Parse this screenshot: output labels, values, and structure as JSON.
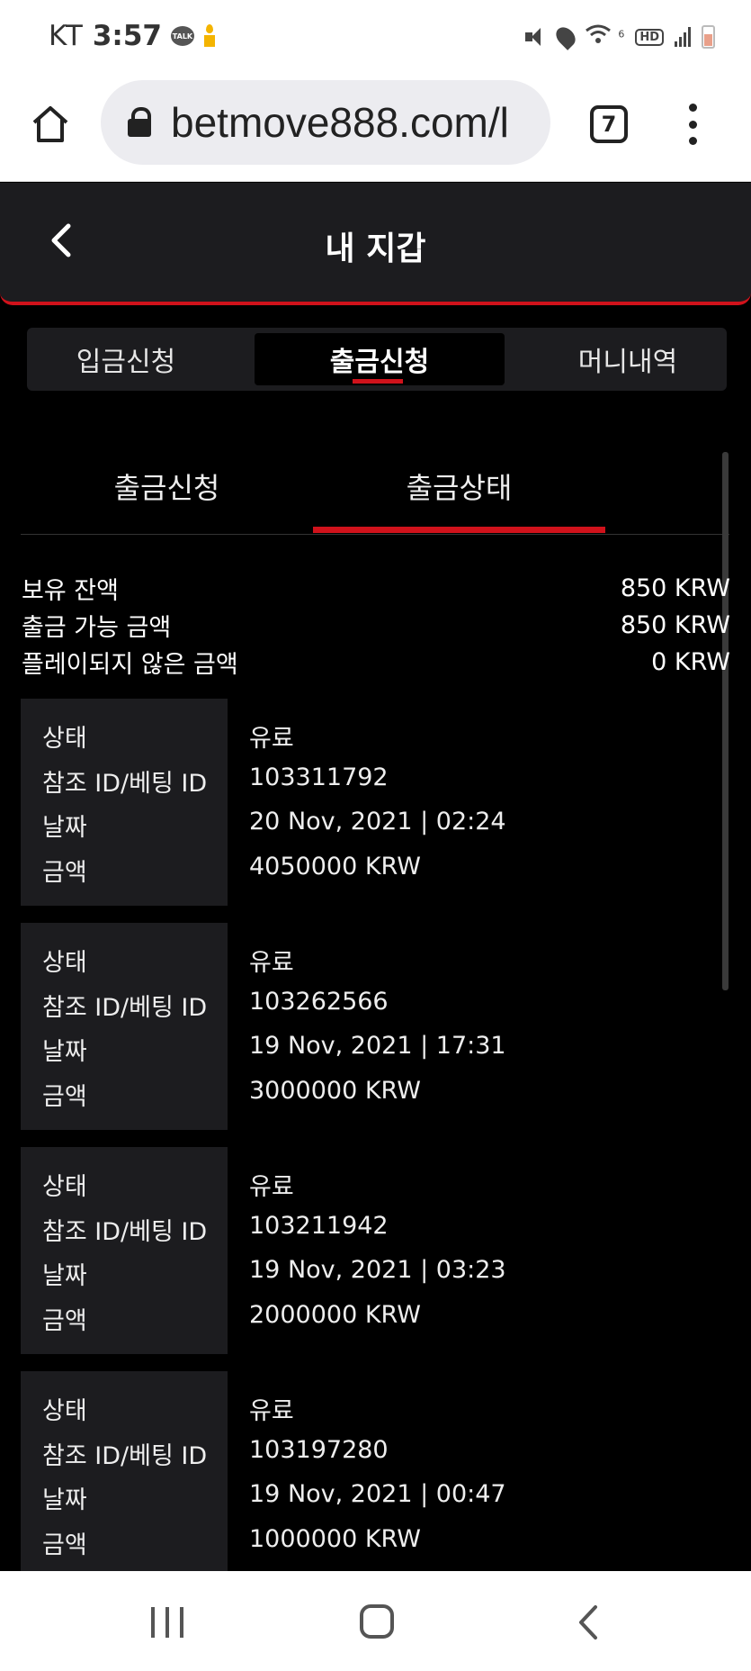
{
  "status_bar": {
    "carrier": "KT",
    "time": "3:57",
    "talk_badge": "TALK",
    "icons": [
      "talk-icon",
      "candle-icon",
      "mute-icon",
      "location-icon",
      "wifi-icon",
      "hd-icon",
      "signal-icon",
      "battery-icon"
    ],
    "hd_label": "HD",
    "wifi_label": "6"
  },
  "browser": {
    "url": "betmove888.com/l",
    "tab_count": "7"
  },
  "header": {
    "title": "내 지갑"
  },
  "main_tabs": [
    {
      "label": "입금신청",
      "active": false
    },
    {
      "label": "출금신청",
      "active": true
    },
    {
      "label": "머니내역",
      "active": false
    }
  ],
  "sub_tabs": [
    {
      "label": "출금신청",
      "active": false
    },
    {
      "label": "출금상태",
      "active": true
    }
  ],
  "balances": [
    {
      "label": "보유 잔액",
      "value": "850 KRW"
    },
    {
      "label": "출금 가능 금액",
      "value": "850 KRW"
    },
    {
      "label": "플레이되지 않은 금액",
      "value": "0 KRW"
    }
  ],
  "record_labels": {
    "status": "상태",
    "ref": "참조 ID/베팅 ID",
    "date": "날짜",
    "amount": "금액"
  },
  "records": [
    {
      "status": "유료",
      "ref": "103311792",
      "date": "20 Nov, 2021 | 02:24",
      "amount": "4050000 KRW"
    },
    {
      "status": "유료",
      "ref": "103262566",
      "date": "19 Nov, 2021 | 17:31",
      "amount": "3000000 KRW"
    },
    {
      "status": "유료",
      "ref": "103211942",
      "date": "19 Nov, 2021 | 03:23",
      "amount": "2000000 KRW"
    },
    {
      "status": "유료",
      "ref": "103197280",
      "date": "19 Nov, 2021 | 00:47",
      "amount": "1000000 KRW"
    }
  ],
  "colors": {
    "accent": "#d0121b",
    "panel": "#1c1c1f",
    "background": "#000000"
  }
}
